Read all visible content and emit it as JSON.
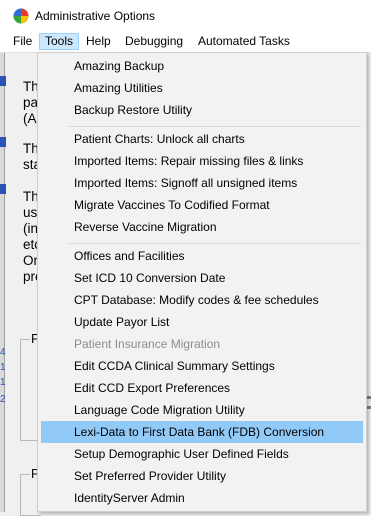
{
  "window": {
    "title": "Administrative Options"
  },
  "menubar": {
    "items": [
      {
        "label": "File"
      },
      {
        "label": "Tools"
      },
      {
        "label": "Help"
      },
      {
        "label": "Debugging"
      },
      {
        "label": "Automated Tasks"
      }
    ]
  },
  "background": {
    "text_fragments": [
      "Th",
      "pa",
      "(A",
      "Th",
      "sta",
      "Th",
      "us",
      "(in",
      "etc",
      "On",
      "pre"
    ],
    "row_numbers": [
      "4",
      "1",
      "1",
      "2"
    ],
    "group_labels": [
      "P",
      "P"
    ]
  },
  "tools_menu": {
    "items": [
      {
        "label": "Amazing Backup"
      },
      {
        "label": "Amazing Utilities"
      },
      {
        "label": "Backup Restore Utility"
      },
      {
        "label": "Patient Charts: Unlock all charts"
      },
      {
        "label": "Imported Items: Repair missing files & links"
      },
      {
        "label": "Imported Items: Signoff all unsigned items"
      },
      {
        "label": "Migrate Vaccines To Codified Format"
      },
      {
        "label": "Reverse Vaccine Migration"
      },
      {
        "label": "Offices and Facilities"
      },
      {
        "label": "Set ICD 10 Conversion Date"
      },
      {
        "label": "CPT Database: Modify codes & fee schedules"
      },
      {
        "label": "Update Payor List"
      },
      {
        "label": "Patient Insurance Migration",
        "disabled": true
      },
      {
        "label": "Edit CCDA Clinical Summary Settings"
      },
      {
        "label": "Edit CCD Export Preferences"
      },
      {
        "label": "Language Code Migration Utility"
      },
      {
        "label": "Lexi-Data to First Data Bank (FDB) Conversion",
        "highlighted": true
      },
      {
        "label": "Setup Demographic User Defined Fields"
      },
      {
        "label": "Set Preferred Provider Utility"
      },
      {
        "label": "IdentityServer Admin"
      }
    ]
  },
  "colors": {
    "menu_highlight": "#91c9f7",
    "active_menu": "#cce8ff",
    "disabled_text": "#8d8d8d"
  }
}
